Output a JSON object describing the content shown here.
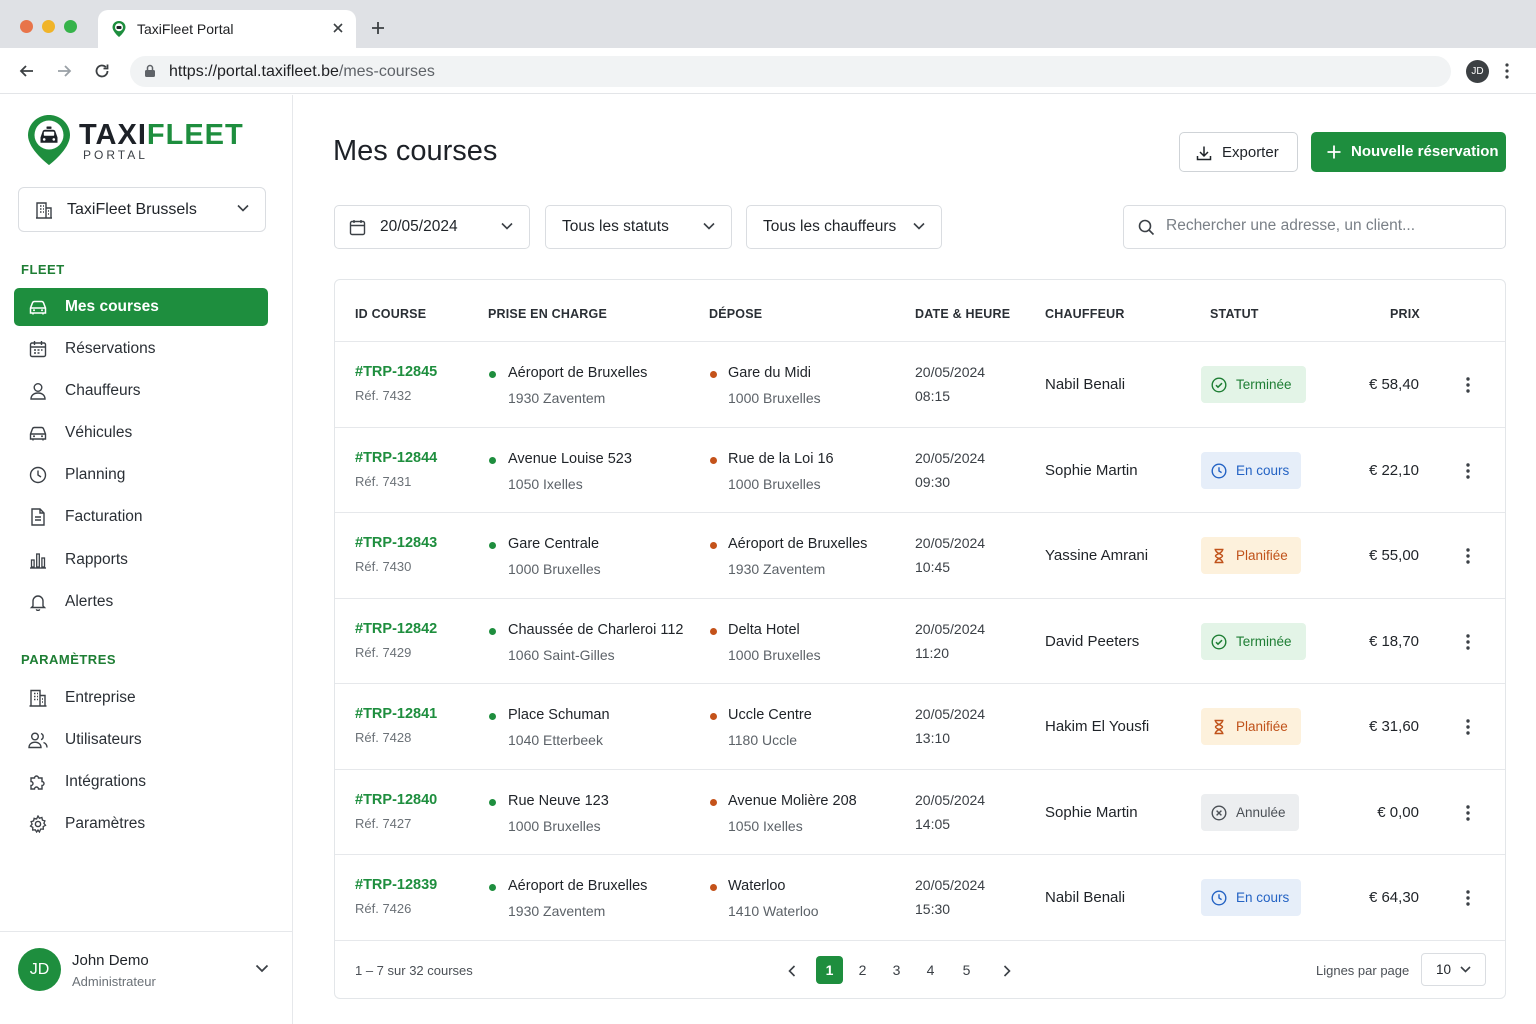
{
  "browser": {
    "tab_title": "TaxiFleet Portal",
    "url_domain": "https://portal.taxifleet.be",
    "url_path": "/mes-courses",
    "profile_initials": "JD"
  },
  "brand": {
    "name_part1": "TAXI",
    "name_part2": "FLEET",
    "subtitle": "PORTAL",
    "accent_color": "#1e8e3e"
  },
  "sidebar": {
    "org_select": "TaxiFleet Brussels",
    "fleet_title": "FLEET",
    "fleet_items": [
      {
        "label": "Mes courses",
        "icon": "car-icon",
        "active": true
      },
      {
        "label": "Réservations",
        "icon": "calendar-icon"
      },
      {
        "label": "Chauffeurs",
        "icon": "user-icon"
      },
      {
        "label": "Véhicules",
        "icon": "car-icon"
      },
      {
        "label": "Planning",
        "icon": "clock-icon"
      },
      {
        "label": "Facturation",
        "icon": "document-icon"
      },
      {
        "label": "Rapports",
        "icon": "bar-chart-icon"
      },
      {
        "label": "Alertes",
        "icon": "bell-icon"
      }
    ],
    "settings_title": "PARAMÈTRES",
    "settings_items": [
      {
        "label": "Entreprise",
        "icon": "building-icon"
      },
      {
        "label": "Utilisateurs",
        "icon": "users-icon"
      },
      {
        "label": "Intégrations",
        "icon": "puzzle-icon"
      },
      {
        "label": "Paramètres",
        "icon": "gear-icon"
      }
    ],
    "user": {
      "initials": "JD",
      "name": "John Demo",
      "role": "Administrateur"
    }
  },
  "main": {
    "title": "Mes courses",
    "export_label": "Exporter",
    "new_label": "Nouvelle réservation",
    "filters": {
      "date": "20/05/2024",
      "status": "Tous les statuts",
      "driver": "Tous les chauffeurs",
      "search_placeholder": "Rechercher une adresse, un client..."
    },
    "table": {
      "headers": {
        "id": "ID COURSE",
        "pickup": "PRISE EN CHARGE",
        "dropoff": "DÉPOSE",
        "datetime": "DATE & HEURE",
        "driver": "CHAUFFEUR",
        "status": "STATUT",
        "price": "PRIX"
      },
      "rows": [
        {
          "id": "#TRP-12845",
          "ref": "Réf. 7432",
          "pickup": "Aéroport de Bruxelles",
          "pickup_city": "1930 Zaventem",
          "dropoff": "Gare du Midi",
          "dropoff_city": "1000 Bruxelles",
          "date": "20/05/2024",
          "time": "08:15",
          "driver": "Nabil Benali",
          "status": "Terminée",
          "status_kind": "done",
          "price": "€ 58,40"
        },
        {
          "id": "#TRP-12844",
          "ref": "Réf. 7431",
          "pickup": "Avenue Louise 523",
          "pickup_city": "1050 Ixelles",
          "dropoff": "Rue de la Loi 16",
          "dropoff_city": "1000 Bruxelles",
          "date": "20/05/2024",
          "time": "09:30",
          "driver": "Sophie Martin",
          "status": "En cours",
          "status_kind": "prog",
          "price": "€ 22,10"
        },
        {
          "id": "#TRP-12843",
          "ref": "Réf. 7430",
          "pickup": "Gare Centrale",
          "pickup_city": "1000 Bruxelles",
          "dropoff": "Aéroport de Bruxelles",
          "dropoff_city": "1930 Zaventem",
          "date": "20/05/2024",
          "time": "10:45",
          "driver": "Yassine Amrani",
          "status": "Planifiée",
          "status_kind": "plan",
          "price": "€ 55,00"
        },
        {
          "id": "#TRP-12842",
          "ref": "Réf. 7429",
          "pickup": "Chaussée de Charleroi 112",
          "pickup_city": "1060 Saint-Gilles",
          "dropoff": "Delta Hotel",
          "dropoff_city": "1000 Bruxelles",
          "date": "20/05/2024",
          "time": "11:20",
          "driver": "David Peeters",
          "status": "Terminée",
          "status_kind": "done",
          "price": "€ 18,70"
        },
        {
          "id": "#TRP-12841",
          "ref": "Réf. 7428",
          "pickup": "Place Schuman",
          "pickup_city": "1040 Etterbeek",
          "dropoff": "Uccle Centre",
          "dropoff_city": "1180 Uccle",
          "date": "20/05/2024",
          "time": "13:10",
          "driver": "Hakim El Yousfi",
          "status": "Planifiée",
          "status_kind": "plan",
          "price": "€ 31,60"
        },
        {
          "id": "#TRP-12840",
          "ref": "Réf. 7427",
          "pickup": "Rue Neuve 123",
          "pickup_city": "1000 Bruxelles",
          "dropoff": "Avenue Molière 208",
          "dropoff_city": "1050 Ixelles",
          "date": "20/05/2024",
          "time": "14:05",
          "driver": "Sophie Martin",
          "status": "Annulée",
          "status_kind": "canc",
          "price": "€ 0,00"
        },
        {
          "id": "#TRP-12839",
          "ref": "Réf. 7426",
          "pickup": "Aéroport de Bruxelles",
          "pickup_city": "1930 Zaventem",
          "dropoff": "Waterloo",
          "dropoff_city": "1410 Waterloo",
          "date": "20/05/2024",
          "time": "15:30",
          "driver": "Nabil Benali",
          "status": "En cours",
          "status_kind": "prog",
          "price": "€ 64,30"
        }
      ]
    },
    "pagination": {
      "info": "1 – 7 sur 32 courses",
      "pages": [
        "1",
        "2",
        "3",
        "4",
        "5"
      ],
      "current": "1",
      "rows_per_page_label": "Lignes par page",
      "rows_per_page": "10"
    }
  }
}
